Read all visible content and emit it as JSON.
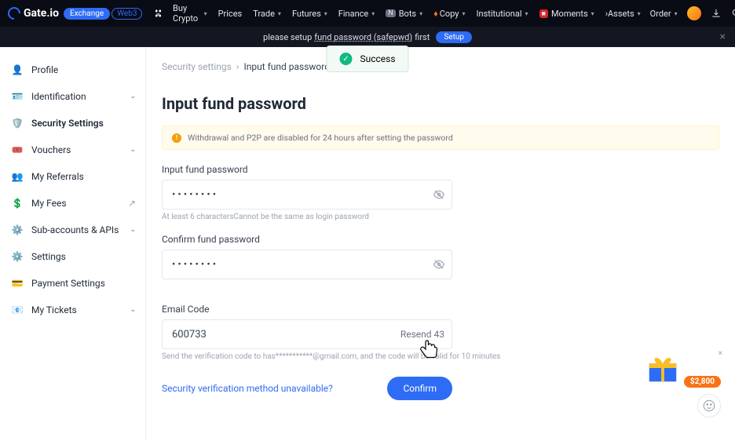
{
  "brand": "Gate.io",
  "nav": {
    "pill1": "Exchange",
    "pill2": "Web3",
    "items": [
      "Buy Crypto",
      "Prices",
      "Trade",
      "Futures",
      "Finance",
      "Bots",
      "Copy",
      "Institutional",
      "Moments"
    ],
    "right": [
      "Assets",
      "Order"
    ]
  },
  "banner": {
    "prefix": "please setup ",
    "link": "fund password (safepwd)",
    "suffix": " first",
    "button": "Setup"
  },
  "toast": {
    "text": "Success"
  },
  "sidebar": [
    {
      "label": "Profile",
      "icon": "user",
      "chevron": false
    },
    {
      "label": "Identification",
      "icon": "id",
      "chevron": true
    },
    {
      "label": "Security Settings",
      "icon": "shield",
      "chevron": false,
      "active": true
    },
    {
      "label": "Vouchers",
      "icon": "voucher",
      "chevron": true
    },
    {
      "label": "My Referrals",
      "icon": "referral",
      "chevron": false
    },
    {
      "label": "My Fees",
      "icon": "fees",
      "chevron": false,
      "ext": true
    },
    {
      "label": "Sub-accounts & APIs",
      "icon": "subacct",
      "chevron": true
    },
    {
      "label": "Settings",
      "icon": "gear",
      "chevron": false
    },
    {
      "label": "Payment Settings",
      "icon": "payment",
      "chevron": false
    },
    {
      "label": "My Tickets",
      "icon": "ticket",
      "chevron": true
    }
  ],
  "breadcrumb": {
    "root": "Security settings",
    "current": "Input fund password"
  },
  "page_title": "Input fund password",
  "warning": "Withdrawal and P2P are disabled for 24 hours after setting the password",
  "fields": {
    "pwd_label": "Input fund password",
    "pwd_value": "••••••••",
    "pwd_hint": "At least 6 charactersCannot be the same as login password",
    "confirm_label": "Confirm fund password",
    "confirm_value": "••••••••",
    "code_label": "Email Code",
    "code_value": "600733",
    "resend": "Resend 43",
    "code_hint": "Send the verification code to has***********@gmail.com, and the code will be valid for 10 minutes"
  },
  "actions": {
    "link": "Security verification method unavailable?",
    "confirm": "Confirm"
  },
  "gift": {
    "amount": "$2,800"
  }
}
